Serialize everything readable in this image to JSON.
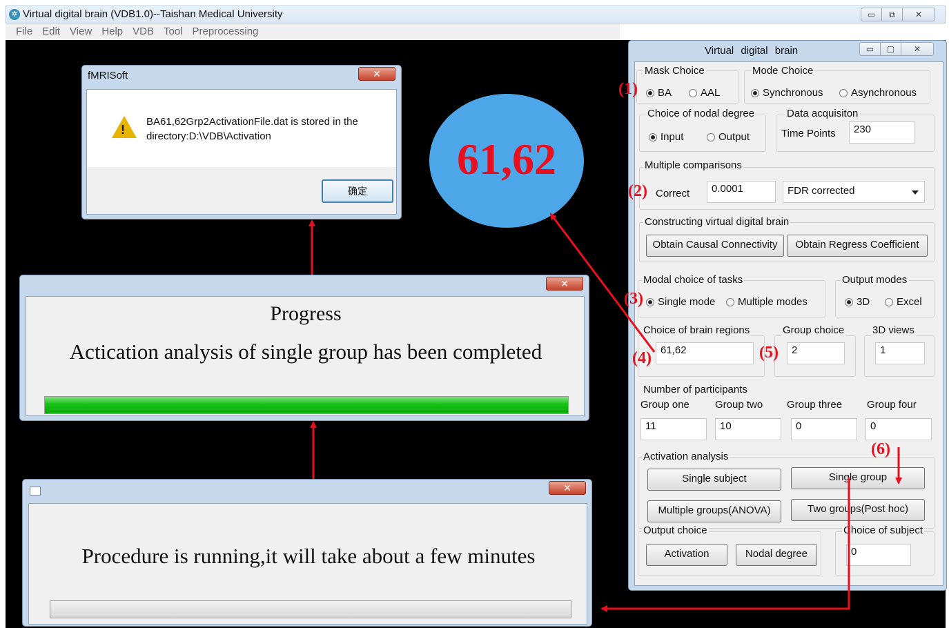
{
  "main_window": {
    "title": "Virtual digital brain (VDB1.0)--Taishan Medical University",
    "menu": [
      "File",
      "Edit",
      "View",
      "Help",
      "VDB",
      "Tool",
      "Preprocessing"
    ]
  },
  "msgbox": {
    "title": "fMRISoft",
    "message": "BA61,62Grp2ActivationFile.dat is stored in the directory:D:\\VDB\\Activation",
    "ok_label": "确定"
  },
  "bubble": {
    "text": "61,62"
  },
  "progress_dialog": {
    "title": "Progress",
    "message": "Actication analysis of single group has been completed",
    "progress": 1.0
  },
  "running_dialog": {
    "message": "Procedure is running,it will take about a few minutes"
  },
  "panel": {
    "title": "Virtual   digital   brain",
    "mask_choice": {
      "label": "Mask Choice",
      "options": [
        "BA",
        "AAL"
      ],
      "selected": "BA"
    },
    "mode_choice": {
      "label": "Mode Choice",
      "options": [
        "Synchronous",
        "Asynchronous"
      ],
      "selected": "Synchronous"
    },
    "nodal_degree": {
      "label": "Choice of nodal degree",
      "options": [
        "Input",
        "Output"
      ],
      "selected": "Input"
    },
    "data_acq": {
      "label": "Data acquisiton",
      "time_points_label": "Time Points",
      "time_points": "230"
    },
    "multiple_comparisons": {
      "label": "Multiple comparisons",
      "correct_label": "Correct",
      "threshold": "0.0001",
      "method": "FDR corrected"
    },
    "constructing": {
      "label": "Constructing virtual digital brain",
      "btn_causal": "Obtain  Causal Connectivity",
      "btn_regress": "Obtain Regress Coefficient"
    },
    "modal_tasks": {
      "label": "Modal choice of tasks",
      "options": [
        "Single mode",
        "Multiple modes"
      ],
      "selected": "Single mode"
    },
    "output_modes": {
      "label": "Output modes",
      "options": [
        "3D",
        "Excel"
      ],
      "selected": "3D"
    },
    "brain_regions": {
      "label": "Choice of brain regions",
      "value": "61,62"
    },
    "group_choice": {
      "label": "Group choice",
      "value": "2"
    },
    "views_3d": {
      "label": "3D views",
      "value": "1"
    },
    "participants": {
      "label": "Number of participants",
      "groups": [
        {
          "name": "Group one",
          "value": "11"
        },
        {
          "name": "Group two",
          "value": "10"
        },
        {
          "name": "Group three",
          "value": "0"
        },
        {
          "name": "Group four",
          "value": "0"
        }
      ]
    },
    "activation": {
      "label": "Activation analysis",
      "btn_single_subject": "Single subject",
      "btn_single_group": "Single group",
      "btn_multiple_groups": "Multiple groups(ANOVA)",
      "btn_two_groups": "Two groups(Post hoc)"
    },
    "output_choice": {
      "label": "Output choice",
      "btn_activation": "Activation",
      "btn_nodal": "Nodal degree"
    },
    "subject_choice": {
      "label": "Choice of subject",
      "value": "0"
    }
  },
  "annotations": [
    "(1)",
    "(2)",
    "(3)",
    "(4)",
    "(5)",
    "(6)"
  ],
  "colors": {
    "annotation_red": "#e8101e",
    "bubble_blue": "#4ca6e8",
    "progress_green": "#15c215"
  }
}
